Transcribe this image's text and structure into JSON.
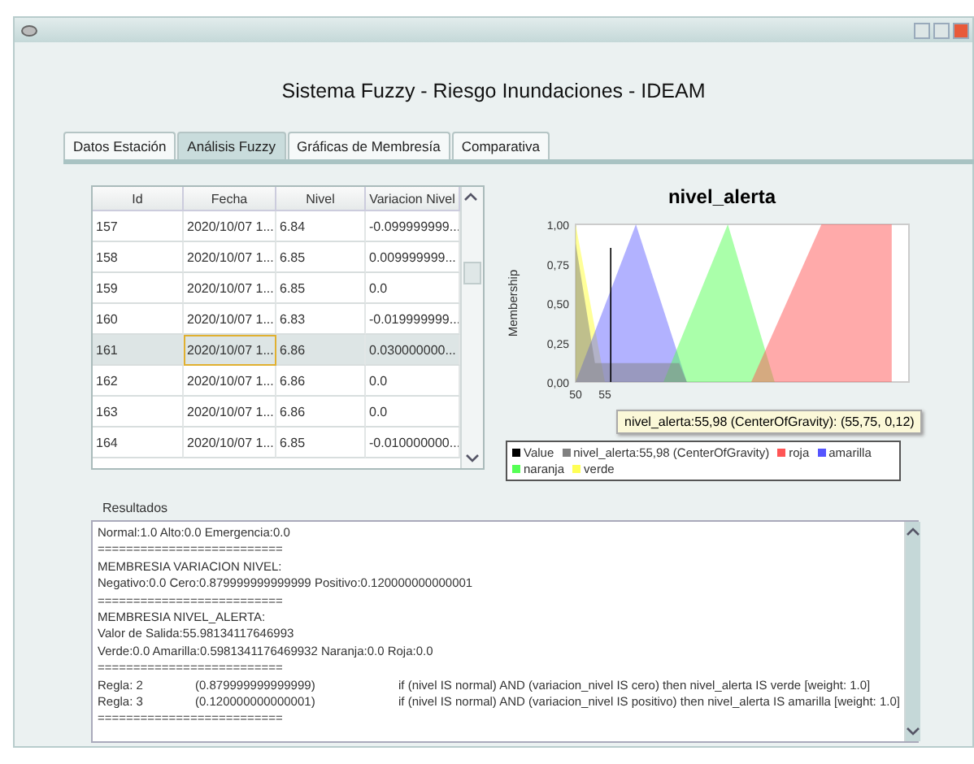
{
  "window": {
    "title": "Sistema Fuzzy - Riesgo Inundaciones - IDEAM"
  },
  "tabs": [
    {
      "label": "Datos Estación",
      "selected": false
    },
    {
      "label": "Análisis Fuzzy",
      "selected": true
    },
    {
      "label": "Gráficas de Membresía",
      "selected": false
    },
    {
      "label": "Comparativa",
      "selected": false
    }
  ],
  "table": {
    "columns": [
      {
        "label": "Id",
        "focused": false
      },
      {
        "label": "Fecha",
        "focused": true
      },
      {
        "label": "Nivel",
        "focused": false
      },
      {
        "label": "Variacion Nivel",
        "focused": false
      }
    ],
    "rows": [
      {
        "cells": [
          "157",
          "2020/10/07 1...",
          "6.84",
          "-0.099999999..."
        ],
        "selected": false
      },
      {
        "cells": [
          "158",
          "2020/10/07 1...",
          "6.85",
          "0.009999999..."
        ],
        "selected": false
      },
      {
        "cells": [
          "159",
          "2020/10/07 1...",
          "6.85",
          "0.0"
        ],
        "selected": false
      },
      {
        "cells": [
          "160",
          "2020/10/07 1...",
          "6.83",
          "-0.019999999..."
        ],
        "selected": false
      },
      {
        "cells": [
          "161",
          "2020/10/07 1...",
          "6.86",
          "0.030000000..."
        ],
        "selected": true
      },
      {
        "cells": [
          "162",
          "2020/10/07 1...",
          "6.86",
          "0.0"
        ],
        "selected": false
      },
      {
        "cells": [
          "163",
          "2020/10/07 1...",
          "6.86",
          "0.0"
        ],
        "selected": false
      },
      {
        "cells": [
          "164",
          "2020/10/07 1...",
          "6.85",
          "-0.010000000..."
        ],
        "selected": false
      }
    ]
  },
  "chart": {
    "title": "nivel_alerta",
    "ylabel": "Membership",
    "yticks": [
      "1,00",
      "0,75",
      "0,50",
      "0,25",
      "0,00"
    ],
    "xticks": [
      "50",
      "55"
    ],
    "tooltip": "nivel_alerta:55,98 (CenterOfGravity): (55,75, 0,12)",
    "legend": [
      {
        "label": "Value",
        "color": "#000000"
      },
      {
        "label": "nivel_alerta:55,98 (CenterOfGravity)",
        "color": "#808080"
      },
      {
        "label": "roja",
        "color": "#ff5555"
      },
      {
        "label": "amarilla",
        "color": "#5555ff"
      },
      {
        "label": "naranja",
        "color": "#55ff55"
      },
      {
        "label": "verde",
        "color": "#ffff55"
      }
    ]
  },
  "results": {
    "label": "Resultados",
    "lines": [
      {
        "kind": "text",
        "text": "Normal:1.0  Alto:0.0  Emergencia:0.0"
      },
      {
        "kind": "text",
        "text": "=========================="
      },
      {
        "kind": "text",
        "text": "MEMBRESIA VARIACION NIVEL:"
      },
      {
        "kind": "text",
        "text": "Negativo:0.0  Cero:0.879999999999999  Positivo:0.120000000000001"
      },
      {
        "kind": "text",
        "text": "=========================="
      },
      {
        "kind": "text",
        "text": "MEMBRESIA NIVEL_ALERTA:"
      },
      {
        "kind": "text",
        "text": "Valor de Salida:55.98134117646993"
      },
      {
        "kind": "text",
        "text": "Verde:0.0  Amarilla:0.5981341176469932  Naranja:0.0  Roja:0.0"
      },
      {
        "kind": "text",
        "text": "=========================="
      },
      {
        "kind": "rule",
        "name": "Regla: 2",
        "value": "(0.879999999999999)",
        "text": "if (nivel IS normal) AND (variacion_nivel IS cero) then nivel_alerta IS verde [weight: 1.0]"
      },
      {
        "kind": "rule",
        "name": "Regla: 3",
        "value": "(0.120000000000001)",
        "text": "if (nivel IS normal) AND (variacion_nivel IS positivo) then nivel_alerta IS amarilla [weight: 1.0]"
      },
      {
        "kind": "text",
        "text": "=========================="
      }
    ]
  }
}
